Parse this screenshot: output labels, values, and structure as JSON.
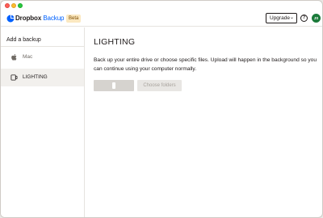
{
  "header": {
    "brand_name": "Dropbox",
    "product_name": "Backup",
    "badge": "Beta",
    "upgrade_label": "Upgrade",
    "help_icon": "question-circle-icon",
    "avatar_initials": "JS",
    "avatar_color": "#1b7a3a"
  },
  "sidebar": {
    "title": "Add a backup",
    "items": [
      {
        "label": "Mac",
        "icon": "apple-icon",
        "active": false
      },
      {
        "label": "LIGHTING",
        "icon": "external-drive-icon",
        "active": true
      }
    ]
  },
  "main": {
    "title": "LIGHTING",
    "description": "Back up your entire drive or choose specific files. Upload will happen in the background so you can continue using your computer normally.",
    "choose_folders_label": "Choose folders"
  },
  "colors": {
    "accent": "#0061fe",
    "badge_bg": "#fbe8c0",
    "active_item_bg": "#f2f0ed",
    "disabled_button": "#d6d3cf"
  }
}
